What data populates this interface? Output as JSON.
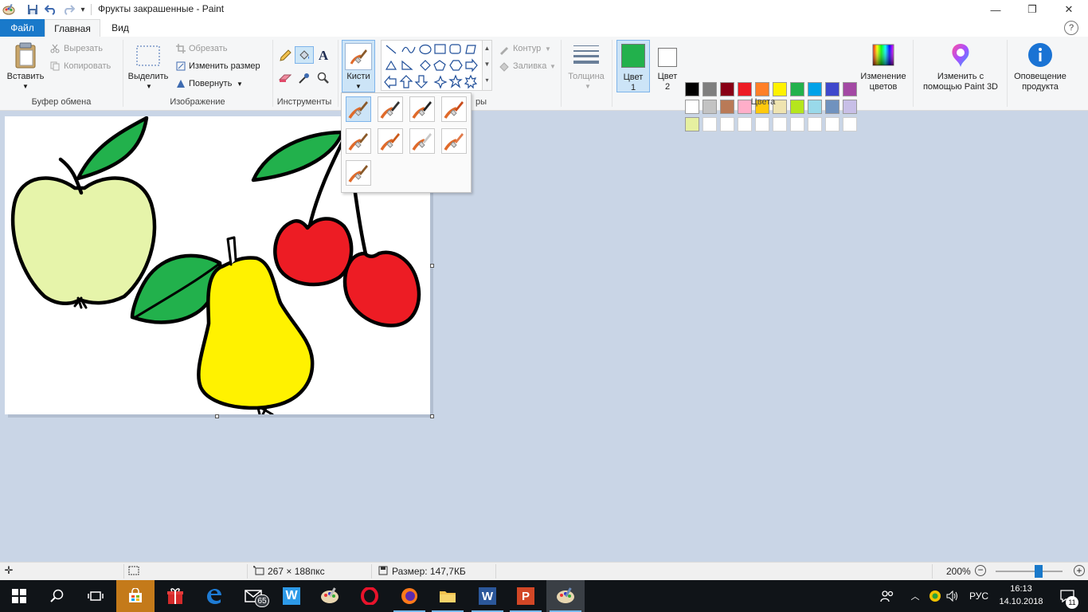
{
  "window": {
    "title": "Фрукты закрашенные - Paint",
    "minimize_glyph": "—",
    "maximize_glyph": "❐",
    "close_glyph": "✕",
    "help_glyph": "?"
  },
  "tabs": {
    "file": "Файл",
    "home": "Главная",
    "view": "Вид"
  },
  "clipboard": {
    "paste": "Вставить",
    "cut": "Вырезать",
    "copy": "Копировать",
    "group": "Буфер обмена"
  },
  "image": {
    "select": "Выделить",
    "crop": "Обрезать",
    "resize": "Изменить размер",
    "rotate": "Повернуть",
    "group": "Изображение"
  },
  "tools": {
    "group": "Инструменты"
  },
  "brushes": {
    "label": "Кисти"
  },
  "shapes": {
    "outline": "Контур",
    "fill": "Заливка",
    "group_partial": "ры"
  },
  "size": {
    "label": "Толщина"
  },
  "colors": {
    "color1": "Цвет 1",
    "color1_line1": "Цвет",
    "color1_line2": "1",
    "color2_line1": "Цвет",
    "color2_line2": "2",
    "color1_value": "#22b14c",
    "color2_value": "#ffffff",
    "edit_line1": "Изменение",
    "edit_line2": "цветов",
    "group": "Цвета",
    "palette_row1": [
      "#000000",
      "#7f7f7f",
      "#880015",
      "#ed1c24",
      "#ff7f27",
      "#fff200",
      "#22b14c",
      "#00a2e8",
      "#3f48cc",
      "#a349a4"
    ],
    "palette_row2": [
      "#ffffff",
      "#c3c3c3",
      "#b97a57",
      "#ffaec9",
      "#ffc90e",
      "#efe4b0",
      "#b5e61d",
      "#99d9ea",
      "#7092be",
      "#c8bfe7"
    ],
    "palette_row3_first": "#e6f0a0"
  },
  "paint3d": {
    "line1": "Изменить с",
    "line2": "помощью Paint 3D"
  },
  "product_alert": {
    "line1": "Оповещение",
    "line2": "продукта"
  },
  "status": {
    "dimensions": "267 × 188пкс",
    "size": "Размер: 147,7КБ",
    "zoom": "200%"
  },
  "taskbar": {
    "mail_badge": "65",
    "lang": "РУС",
    "time": "16:13",
    "date": "14.10.2018",
    "notifications": "11"
  }
}
